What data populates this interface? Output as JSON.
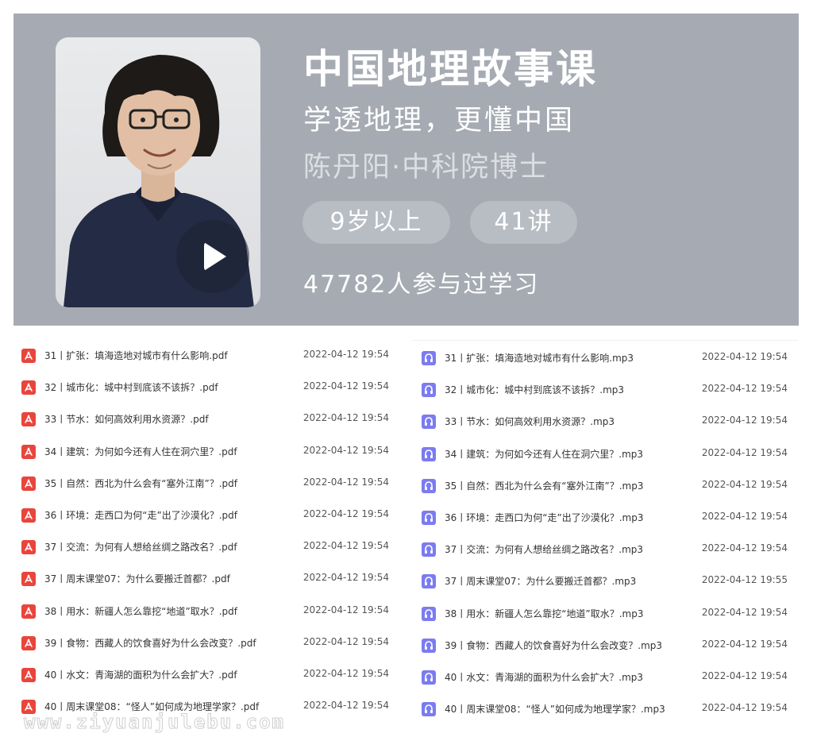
{
  "course": {
    "title": "中国地理故事课",
    "subtitle": "学透地理，更懂中国",
    "author": "陈丹阳·中科院博士",
    "age_tag": "9岁以上",
    "lessons_tag": "41讲",
    "learners": "47782人参与过学习"
  },
  "colors": {
    "banner_bg": "#a6abb3",
    "pdf_icon": "#e8453c",
    "audio_icon": "#7b7cf0"
  },
  "pdf_files": [
    {
      "name": "31丨扩张：填海造地对城市有什么影响.pdf",
      "date": "2022-04-12 19:54"
    },
    {
      "name": "32丨城市化：城中村到底该不该拆？.pdf",
      "date": "2022-04-12 19:54"
    },
    {
      "name": "33丨节水：如何高效利用水资源？.pdf",
      "date": "2022-04-12 19:54"
    },
    {
      "name": "34丨建筑：为何如今还有人住在洞穴里？.pdf",
      "date": "2022-04-12 19:54"
    },
    {
      "name": "35丨自然：西北为什么会有“塞外江南”？.pdf",
      "date": "2022-04-12 19:54"
    },
    {
      "name": "36丨环境：走西口为何“走”出了沙漠化？.pdf",
      "date": "2022-04-12 19:54"
    },
    {
      "name": "37丨交流：为何有人想给丝绸之路改名？.pdf",
      "date": "2022-04-12 19:54"
    },
    {
      "name": "37丨周末课堂07：为什么要搬迁首都？.pdf",
      "date": "2022-04-12 19:54"
    },
    {
      "name": "38丨用水：新疆人怎么靠挖“地道”取水？.pdf",
      "date": "2022-04-12 19:54"
    },
    {
      "name": "39丨食物：西藏人的饮食喜好为什么会改变？.pdf",
      "date": "2022-04-12 19:54"
    },
    {
      "name": "40丨水文：青海湖的面积为什么会扩大？.pdf",
      "date": "2022-04-12 19:54"
    },
    {
      "name": "40丨周末课堂08：“怪人”如何成为地理学家？.pdf",
      "date": "2022-04-12 19:54"
    }
  ],
  "audio_files": [
    {
      "name": "31丨扩张：填海造地对城市有什么影响.mp3",
      "date": "2022-04-12 19:54"
    },
    {
      "name": "32丨城市化：城中村到底该不该拆？.mp3",
      "date": "2022-04-12 19:54"
    },
    {
      "name": "33丨节水：如何高效利用水资源？.mp3",
      "date": "2022-04-12 19:54"
    },
    {
      "name": "34丨建筑：为何如今还有人住在洞穴里？.mp3",
      "date": "2022-04-12 19:54"
    },
    {
      "name": "35丨自然：西北为什么会有“塞外江南”？.mp3",
      "date": "2022-04-12 19:54"
    },
    {
      "name": "36丨环境：走西口为何“走”出了沙漠化？.mp3",
      "date": "2022-04-12 19:54"
    },
    {
      "name": "37丨交流：为何有人想给丝绸之路改名？.mp3",
      "date": "2022-04-12 19:54"
    },
    {
      "name": "37丨周末课堂07：为什么要搬迁首都？.mp3",
      "date": "2022-04-12 19:55"
    },
    {
      "name": "38丨用水：新疆人怎么靠挖“地道”取水？.mp3",
      "date": "2022-04-12 19:54"
    },
    {
      "name": "39丨食物：西藏人的饮食喜好为什么会改变？.mp3",
      "date": "2022-04-12 19:54"
    },
    {
      "name": "40丨水文：青海湖的面积为什么会扩大？.mp3",
      "date": "2022-04-12 19:54"
    },
    {
      "name": "40丨周末课堂08：“怪人”如何成为地理学家？.mp3",
      "date": "2022-04-12 19:54"
    }
  ],
  "watermark": "www.ziyuanjulebu.com"
}
